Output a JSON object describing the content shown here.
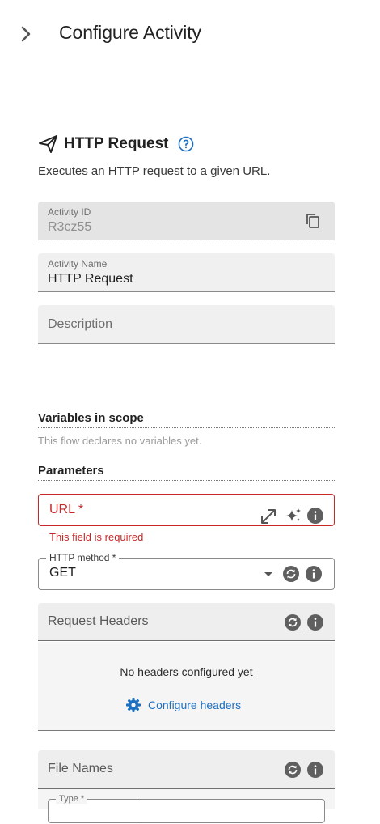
{
  "header": {
    "title": "Configure Activity",
    "expand_icon": "chevron-right-icon"
  },
  "activity": {
    "icon": "send-icon",
    "title": "HTTP Request",
    "help_icon": "help-circle-icon",
    "description": "Executes an HTTP request to a given URL."
  },
  "fields": {
    "activity_id": {
      "label": "Activity ID",
      "value": "R3cz55",
      "copy_icon": "copy-icon"
    },
    "activity_name": {
      "label": "Activity Name",
      "value": "HTTP Request"
    },
    "description": {
      "placeholder": "Description",
      "value": ""
    }
  },
  "variables": {
    "heading": "Variables in scope",
    "note": "This flow declares no variables yet."
  },
  "parameters": {
    "heading": "Parameters",
    "url": {
      "label": "URL *",
      "error": "This field is required",
      "icons": [
        "expand-icon",
        "sparkle-icon",
        "info-icon"
      ]
    },
    "http_method": {
      "label": "HTTP method *",
      "value": "GET",
      "icons": [
        "dropdown-arrow-icon",
        "sync-icon",
        "info-icon"
      ]
    }
  },
  "request_headers": {
    "title": "Request Headers",
    "icons": [
      "sync-icon",
      "info-icon"
    ],
    "empty_text": "No headers configured yet",
    "configure_label": "Configure headers",
    "configure_icon": "gear-icon"
  },
  "file_names": {
    "title": "File Names",
    "icons": [
      "sync-icon",
      "info-icon"
    ],
    "type_label": "Type *"
  },
  "colors": {
    "error": "#c62828",
    "accent": "#1f6fbf",
    "field_bg": "#f0f0f0"
  }
}
